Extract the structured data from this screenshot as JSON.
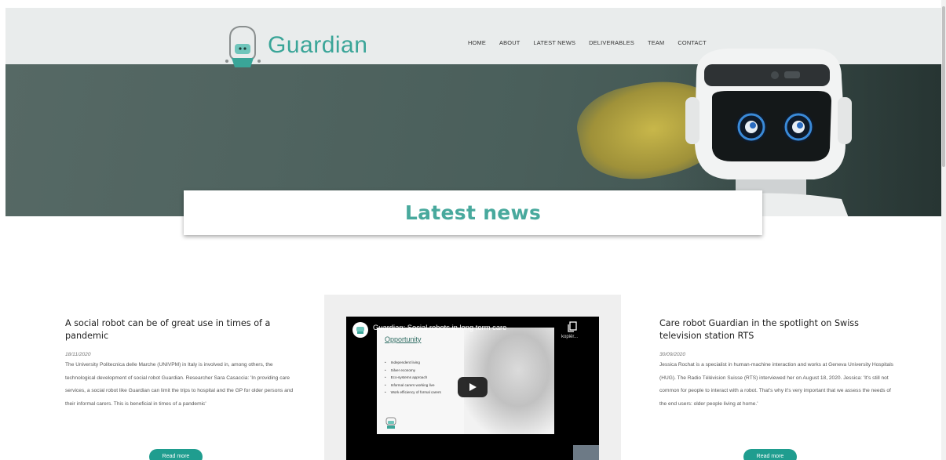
{
  "brand": {
    "name": "Guardian",
    "color": "#3aa598"
  },
  "nav": {
    "items": [
      {
        "label": "HOME"
      },
      {
        "label": "ABOUT"
      },
      {
        "label": "LATEST NEWS"
      },
      {
        "label": "DELIVERABLES"
      },
      {
        "label": "TEAM"
      },
      {
        "label": "CONTACT"
      }
    ]
  },
  "section_title": "Latest news",
  "accent_color": "#1f9d8f",
  "articles": [
    {
      "title": "A social robot can be of great use in times of a pandemic",
      "date": "18/11/2020",
      "excerpt": "The University Politecnica delle Marche (UNIVPM) in Italy is involved in, among others, the technological development of social robot Guardian. Researcher Sara Casaccia: 'In providing care services, a social robot like Guardian can limit the trips to hospital and the GP for older persons and their informal carers. This is beneficial in times of a pandemic'",
      "read_more": "Read more"
    },
    {
      "title": "Care robot Guardian in the spotlight on Swiss television station RTS",
      "date": "30/09/2020",
      "excerpt": "Jessica Rochat is a specialist in human-machine interaction and works at Geneva University Hospitals (HUG). The Radio Télévision Suisse (RTS) interviewed her on August 18, 2020. Jessica: 'It's still not common for people to interact with a robot. That's why it's very important that we assess the needs of the end users: older people living at home.'",
      "read_more": "Read more"
    }
  ],
  "video": {
    "title": "Guardian: Social robots in long term care",
    "copy_label": "kopiër...",
    "slide_title": "Opportunity",
    "slide_items": [
      "Independent living",
      "Silver economy",
      "Eco-systems approach",
      "Informal carers working live",
      "Work efficiency of formal carers"
    ],
    "icons": [
      "play-icon",
      "copy-icon"
    ]
  }
}
